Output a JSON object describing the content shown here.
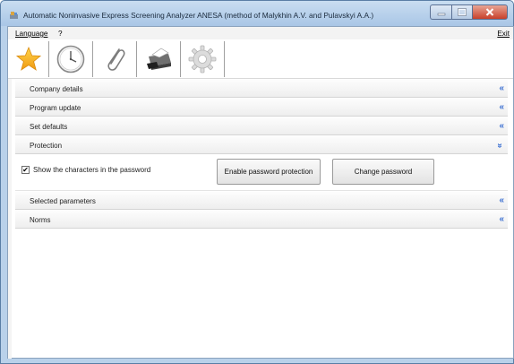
{
  "window": {
    "title": "Automatic Noninvasive Express Screening Analyzer ANESA (method of Malykhin A.V. and Pulavskyi A.A.)",
    "controls": [
      "minimize",
      "maximize",
      "close"
    ]
  },
  "menu": {
    "language": "Language",
    "help": "?",
    "exit": "Exit"
  },
  "toolbar": {
    "icons": [
      "star-icon",
      "clock-icon",
      "paperclip-icon",
      "printer-icon",
      "gear-icon"
    ]
  },
  "panels": {
    "company": {
      "label": "Company details",
      "state": "collapsed"
    },
    "update": {
      "label": "Program update",
      "state": "collapsed"
    },
    "defaults": {
      "label": "Set defaults",
      "state": "collapsed"
    },
    "protection": {
      "label": "Protection",
      "state": "expanded",
      "checkbox_label": "Show the characters in the password",
      "checkbox_checked": true,
      "enable_button": "Enable password protection",
      "change_button": "Change password"
    },
    "selected": {
      "label": "Selected parameters",
      "state": "collapsed"
    },
    "norms": {
      "label": "Norms",
      "state": "collapsed"
    }
  },
  "colors": {
    "accent": "#3b6fd1",
    "title_bar": "#b9d1ea",
    "close_button": "#c8402a"
  }
}
